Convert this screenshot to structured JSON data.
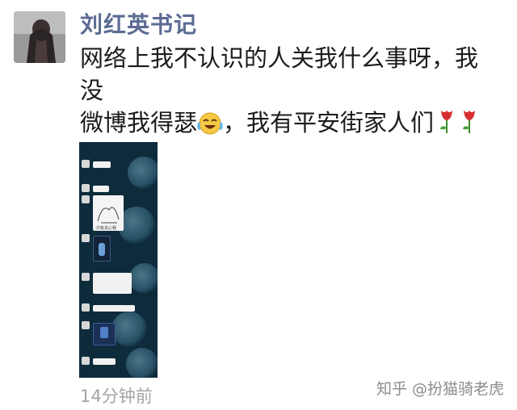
{
  "post": {
    "author_name": "刘红英书记",
    "text_line1": "网络上我不认识的人关我什么事呀，我没",
    "text_line2a": "微博我得瑟",
    "text_line2b": "，我有平安街家人们",
    "time": "14分钟前"
  },
  "icons": {
    "avatar": "avatar-photo",
    "emoji": "laughing-crying-emoji-icon",
    "tulip": "tulip-emoji-icon"
  },
  "image": {
    "semantic": "chat-screenshot-thumbnail",
    "caption_in_image": "只有关心我"
  },
  "watermark": "知乎 @扮猫骑老虎",
  "colors": {
    "name": "#5b6b93",
    "text": "#1c1c1c",
    "time": "#a3a3a3",
    "image_bg": "#0e2b3c"
  }
}
